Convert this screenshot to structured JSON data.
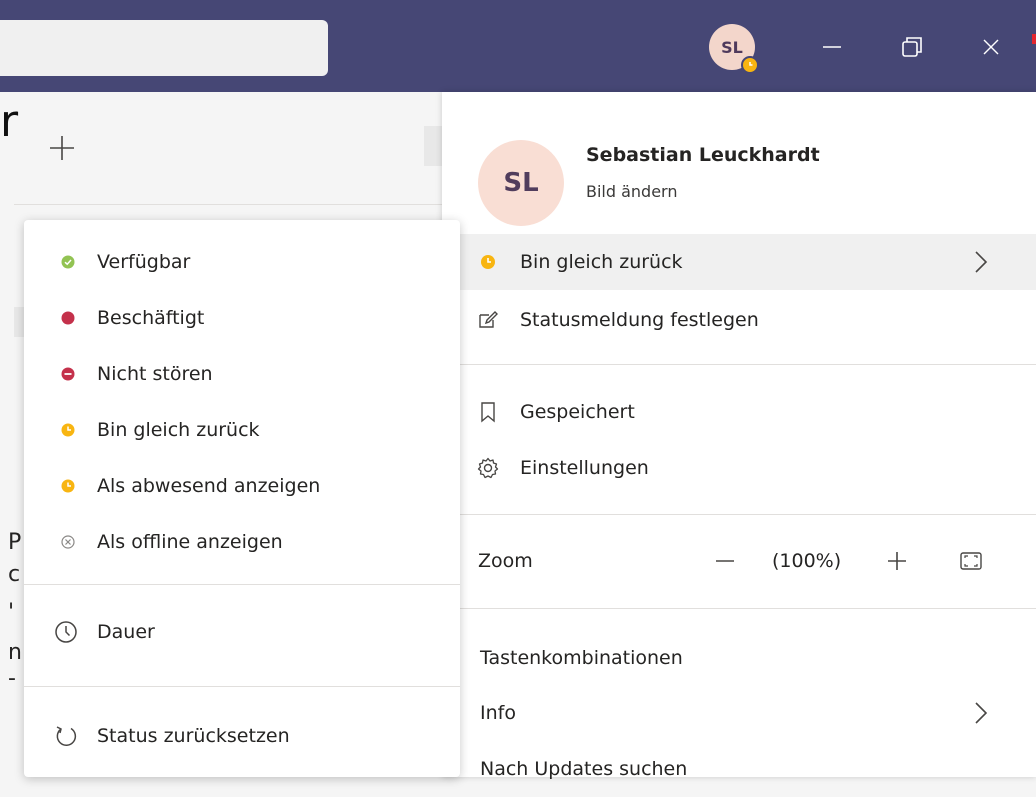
{
  "titlebar": {
    "avatar_initials": "SL",
    "avatar_status_color": "#f8b511",
    "accent_color": "#464775"
  },
  "background": {
    "fragment_r": "r",
    "fragment_chars": [
      "P",
      "c",
      "'",
      "n",
      "-"
    ]
  },
  "profile": {
    "initials": "SL",
    "name": "Sebastian Leuckhardt",
    "change_picture": "Bild ändern"
  },
  "main_menu": {
    "current_status": "Bin gleich zurück",
    "set_status_message": "Statusmeldung festlegen",
    "saved": "Gespeichert",
    "settings": "Einstellungen",
    "zoom_label": "Zoom",
    "zoom_value": "(100%)",
    "shortcuts": "Tastenkombinationen",
    "info": "Info",
    "check_updates": "Nach Updates suchen"
  },
  "status_menu": {
    "items": [
      {
        "label": "Verfügbar",
        "color": "#92c353",
        "icon": "check-circle-icon"
      },
      {
        "label": "Beschäftigt",
        "color": "#c4314b",
        "icon": "busy-dot-icon"
      },
      {
        "label": "Nicht stören",
        "color": "#c4314b",
        "icon": "do-not-disturb-icon"
      },
      {
        "label": "Bin gleich zurück",
        "color": "#f8b511",
        "icon": "clock-dot-icon"
      },
      {
        "label": "Als abwesend anzeigen",
        "color": "#f8b511",
        "icon": "clock-dot-icon"
      },
      {
        "label": "Als offline anzeigen",
        "color": "#8a8886",
        "icon": "offline-x-icon"
      }
    ],
    "duration": "Dauer",
    "reset_status": "Status zurücksetzen"
  }
}
